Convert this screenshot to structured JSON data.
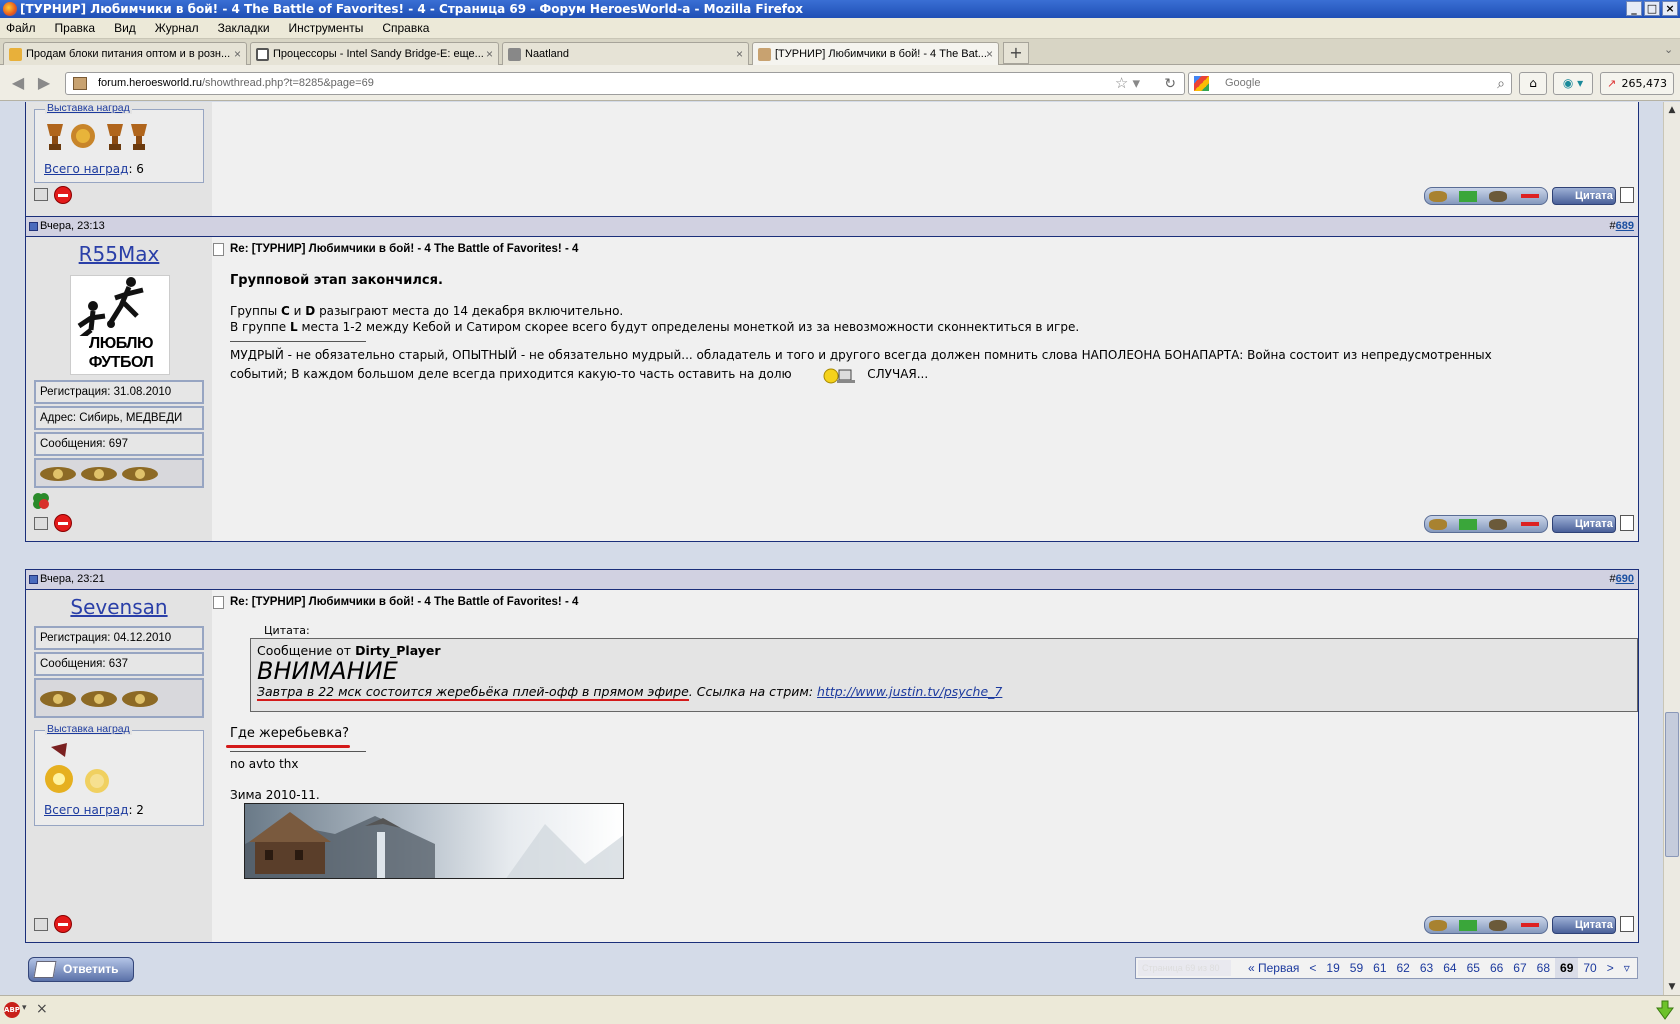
{
  "window": {
    "title": "[ТУРНИР] Любимчики в бой! - 4 The Battle of Favorites! - 4 - Страница 69 - Форум HeroesWorld-а - Mozilla Firefox"
  },
  "menu": [
    "Файл",
    "Правка",
    "Вид",
    "Журнал",
    "Закладки",
    "Инструменты",
    "Справка"
  ],
  "tabs": [
    {
      "label": "Продам блоки питания оптом и в розн...",
      "close": "×",
      "icon_color": "#e8b03a"
    },
    {
      "label": "Процессоры - Intel Sandy Bridge-E: еще...",
      "close": "×",
      "icon_color": "#555555"
    },
    {
      "label": "Naatland",
      "close": "×",
      "icon_color": "#888888"
    },
    {
      "label": "[ТУРНИР] Любимчики в бой! - 4 The Bat...",
      "close": "×",
      "icon_color": "#c8a270"
    }
  ],
  "new_tab": "+",
  "nav": {
    "url_host": "forum.heroesworld.ru",
    "url_path": "/showthread.php?t=8285&page=69",
    "search_engine": "Google",
    "counter": "265,473"
  },
  "post_top": {
    "awards_title": "Выставка наград",
    "awards_total_label": "Всего наград",
    "awards_total_value": ": 6",
    "quote_btn": "Цитата"
  },
  "post_689": {
    "date": "Вчера, 23:13",
    "number_prefix": "#",
    "number": "689",
    "username": "R55Max",
    "avatar_text": [
      "ЛЮБЛЮ",
      "ФУТБОЛ"
    ],
    "registration": "Регистрация: 31.08.2010",
    "address": "Адрес: Сибирь, МЕДВЕДИ",
    "messages": "Сообщения: 697",
    "title": "Re: [ТУРНИР] Любимчики в бой! - 4 The Battle of Favorites! - 4",
    "heading": "Групповой этап закончился.",
    "line1_a": "Группы ",
    "line1_b": "C",
    "line1_c": " и ",
    "line1_d": "D",
    "line1_e": " разыграют места до 14 декабря включительно.",
    "line2_a": "В группе ",
    "line2_b": "L",
    "line2_c": " места 1-2 между Кебой и Сатиром скорее всего будут определены монеткой из за невозможности сконнектиться в игре.",
    "sig1": "МУДРЫЙ - не обязательно старый, ОПЫТНЫЙ - не обязательно мудрый... обладатель и того и другого всегда должен помнить слова НАПОЛЕОНА БОНАПАРТА: Война состоит из непредусмотренных",
    "sig2": "событий; В каждом большом деле всегда приходится какую-то часть оставить на долю",
    "sig3": "СЛУЧАЯ...",
    "quote_btn": "Цитата"
  },
  "post_690": {
    "date": "Вчера, 23:21",
    "number_prefix": "#",
    "number": "690",
    "username": "Sevensan",
    "registration": "Регистрация: 04.12.2010",
    "messages": "Сообщения: 637",
    "awards_title": "Выставка наград",
    "awards_total_label": "Всего наград",
    "awards_total_value": ": 2",
    "title": "Re: [ТУРНИР] Любимчики в бой! - 4 The Battle of Favorites! - 4",
    "quote_label": "Цитата:",
    "quote_from_prefix": "Сообщение от ",
    "quote_author": "Dirty_Player",
    "quote_heading": "ВНИМАНИЕ",
    "quote_text": "Завтра в 22 мск состоится жеребьёка плей-офф в прямом эфире",
    "quote_link_prefix": ". Ссылка на стрим: ",
    "quote_link": "http://www.justin.tv/psyche_7",
    "reply": "Где жеребьевка?",
    "sig1": "no avto thx",
    "sig2": "Зима 2010-11.",
    "quote_btn": "Цитата"
  },
  "reply_button": "Ответить",
  "pager": {
    "label": "Страница 69 из 80",
    "first": "« Первая",
    "prev": "<",
    "pages": [
      "19",
      "59",
      "61",
      "62",
      "63",
      "64",
      "65",
      "66",
      "67",
      "68",
      "69",
      "70"
    ],
    "current": "69",
    "next": ">"
  },
  "statusbar": {
    "close": "×"
  }
}
